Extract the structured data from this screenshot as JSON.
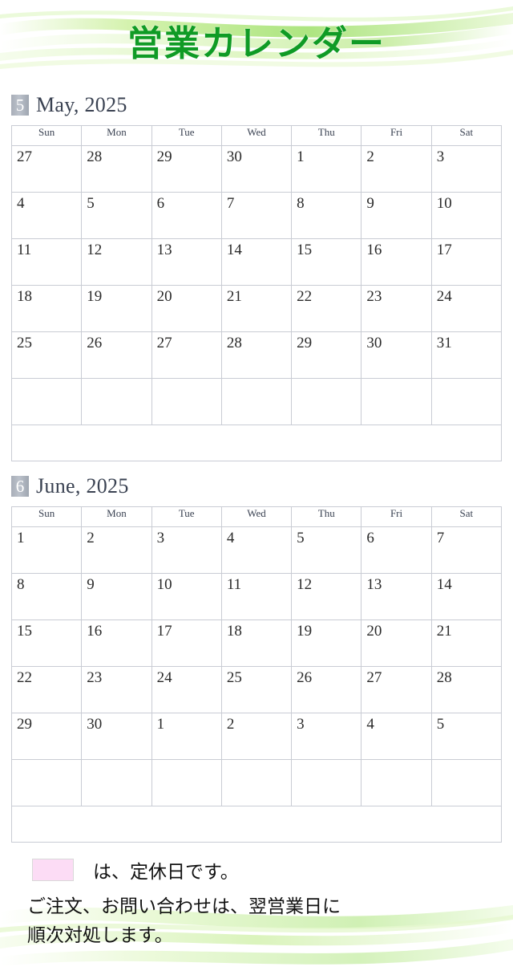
{
  "header": {
    "title": "営業カレンダー",
    "accent_color": "#0f9b25",
    "wave_color": "#b5e87a"
  },
  "weekday_headers": [
    "Sun",
    "Mon",
    "Tue",
    "Wed",
    "Thu",
    "Fri",
    "Sat"
  ],
  "legend": {
    "swatch_color": "#fcdcf5",
    "text": "は、定休日です。"
  },
  "notes": {
    "line1": "ご注文、お問い合わせは、翌営業日に",
    "line2": "順次対処します。"
  },
  "months": [
    {
      "badge": "5",
      "title": "May, 2025",
      "weeks": [
        [
          {
            "d": "27",
            "type": "other-sun"
          },
          {
            "d": "28",
            "type": "other"
          },
          {
            "d": "29",
            "type": "other-sun"
          },
          {
            "d": "30",
            "type": "other"
          },
          {
            "d": "1",
            "type": "normal"
          },
          {
            "d": "2",
            "type": "normal"
          },
          {
            "d": "3",
            "type": "holiday"
          }
        ],
        [
          {
            "d": "4",
            "type": "sun",
            "closed": true
          },
          {
            "d": "5",
            "type": "holiday"
          },
          {
            "d": "6",
            "type": "holiday"
          },
          {
            "d": "7",
            "type": "normal"
          },
          {
            "d": "8",
            "type": "normal"
          },
          {
            "d": "9",
            "type": "normal"
          },
          {
            "d": "10",
            "type": "sat"
          }
        ],
        [
          {
            "d": "11",
            "type": "sun"
          },
          {
            "d": "12",
            "type": "normal"
          },
          {
            "d": "13",
            "type": "normal"
          },
          {
            "d": "14",
            "type": "normal"
          },
          {
            "d": "15",
            "type": "normal"
          },
          {
            "d": "16",
            "type": "normal"
          },
          {
            "d": "17",
            "type": "sat"
          }
        ],
        [
          {
            "d": "18",
            "type": "sun",
            "closed": true
          },
          {
            "d": "19",
            "type": "normal"
          },
          {
            "d": "20",
            "type": "normal"
          },
          {
            "d": "21",
            "type": "normal"
          },
          {
            "d": "22",
            "type": "normal"
          },
          {
            "d": "23",
            "type": "normal"
          },
          {
            "d": "24",
            "type": "sat"
          }
        ],
        [
          {
            "d": "25",
            "type": "sun"
          },
          {
            "d": "26",
            "type": "normal"
          },
          {
            "d": "27",
            "type": "normal"
          },
          {
            "d": "28",
            "type": "normal"
          },
          {
            "d": "29",
            "type": "normal"
          },
          {
            "d": "30",
            "type": "normal"
          },
          {
            "d": "31",
            "type": "sat"
          }
        ],
        [
          {
            "d": "",
            "type": "normal"
          },
          {
            "d": "",
            "type": "normal"
          },
          {
            "d": "",
            "type": "normal"
          },
          {
            "d": "",
            "type": "normal"
          },
          {
            "d": "",
            "type": "normal"
          },
          {
            "d": "",
            "type": "normal"
          },
          {
            "d": "",
            "type": "normal"
          }
        ]
      ]
    },
    {
      "badge": "6",
      "title": "June, 2025",
      "weeks": [
        [
          {
            "d": "1",
            "type": "sun",
            "closed": true
          },
          {
            "d": "2",
            "type": "normal"
          },
          {
            "d": "3",
            "type": "normal"
          },
          {
            "d": "4",
            "type": "normal"
          },
          {
            "d": "5",
            "type": "normal"
          },
          {
            "d": "6",
            "type": "normal"
          },
          {
            "d": "7",
            "type": "sat"
          }
        ],
        [
          {
            "d": "8",
            "type": "sun"
          },
          {
            "d": "9",
            "type": "normal"
          },
          {
            "d": "10",
            "type": "normal"
          },
          {
            "d": "11",
            "type": "normal"
          },
          {
            "d": "12",
            "type": "normal"
          },
          {
            "d": "13",
            "type": "normal"
          },
          {
            "d": "14",
            "type": "sat"
          }
        ],
        [
          {
            "d": "15",
            "type": "sun",
            "closed": true
          },
          {
            "d": "16",
            "type": "normal"
          },
          {
            "d": "17",
            "type": "normal"
          },
          {
            "d": "18",
            "type": "normal"
          },
          {
            "d": "19",
            "type": "normal"
          },
          {
            "d": "20",
            "type": "normal"
          },
          {
            "d": "21",
            "type": "sat"
          }
        ],
        [
          {
            "d": "22",
            "type": "sun"
          },
          {
            "d": "23",
            "type": "normal"
          },
          {
            "d": "24",
            "type": "normal"
          },
          {
            "d": "25",
            "type": "normal"
          },
          {
            "d": "26",
            "type": "normal"
          },
          {
            "d": "27",
            "type": "normal"
          },
          {
            "d": "28",
            "type": "sat"
          }
        ],
        [
          {
            "d": "29",
            "type": "sun",
            "closed": true
          },
          {
            "d": "30",
            "type": "normal"
          },
          {
            "d": "1",
            "type": "other"
          },
          {
            "d": "2",
            "type": "other"
          },
          {
            "d": "3",
            "type": "other"
          },
          {
            "d": "4",
            "type": "other"
          },
          {
            "d": "5",
            "type": "other-sat"
          }
        ],
        [
          {
            "d": "",
            "type": "normal"
          },
          {
            "d": "",
            "type": "normal"
          },
          {
            "d": "",
            "type": "normal"
          },
          {
            "d": "",
            "type": "normal"
          },
          {
            "d": "",
            "type": "normal"
          },
          {
            "d": "",
            "type": "normal"
          },
          {
            "d": "",
            "type": "normal"
          }
        ]
      ]
    }
  ]
}
